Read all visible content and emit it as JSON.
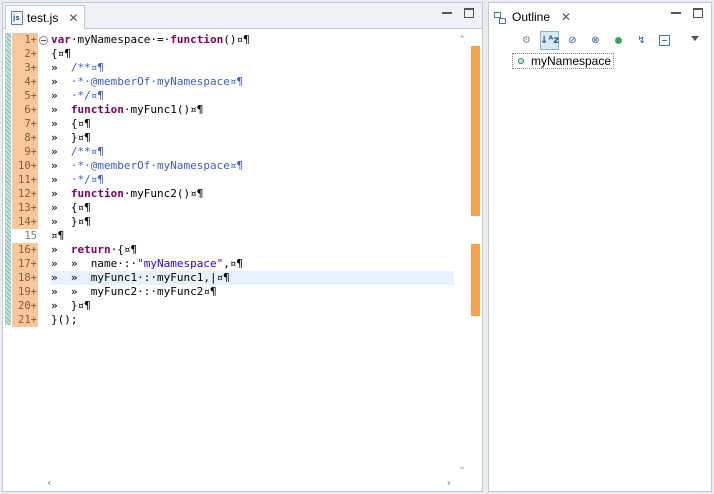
{
  "editor": {
    "tab_label": "test.js",
    "line_numbers": [
      {
        "num": "1+",
        "changed": true
      },
      {
        "num": "2+",
        "changed": true
      },
      {
        "num": "3+",
        "changed": true
      },
      {
        "num": "4+",
        "changed": true
      },
      {
        "num": "5+",
        "changed": true
      },
      {
        "num": "6+",
        "changed": true
      },
      {
        "num": "7+",
        "changed": true
      },
      {
        "num": "8+",
        "changed": true
      },
      {
        "num": "9+",
        "changed": true
      },
      {
        "num": "10+",
        "changed": true
      },
      {
        "num": "11+",
        "changed": true
      },
      {
        "num": "12+",
        "changed": true
      },
      {
        "num": "13+",
        "changed": true
      },
      {
        "num": "14+",
        "changed": true
      },
      {
        "num": "15",
        "changed": false
      },
      {
        "num": "16+",
        "changed": true
      },
      {
        "num": "17+",
        "changed": true
      },
      {
        "num": "18+",
        "changed": true
      },
      {
        "num": "19+",
        "changed": true
      },
      {
        "num": "20+",
        "changed": true
      },
      {
        "num": "21+",
        "changed": true
      }
    ],
    "code_lines": [
      [
        [
          "kw",
          "var"
        ],
        [
          "",
          "·myNamespace·=·"
        ],
        [
          "kw",
          "function"
        ],
        [
          "",
          "()¤¶"
        ]
      ],
      [
        [
          "",
          "{¤¶"
        ]
      ],
      [
        [
          "",
          "»  "
        ],
        [
          "cm",
          "/**¤¶"
        ]
      ],
      [
        [
          "",
          "»  "
        ],
        [
          "cm",
          "·*·@memberOf·myNamespace¤¶"
        ]
      ],
      [
        [
          "",
          "»  "
        ],
        [
          "cm",
          "·*/¤¶"
        ]
      ],
      [
        [
          "",
          "»  "
        ],
        [
          "kw",
          "function"
        ],
        [
          "",
          "·myFunc1()¤¶"
        ]
      ],
      [
        [
          "",
          "»  {¤¶"
        ]
      ],
      [
        [
          "",
          "»  }¤¶"
        ]
      ],
      [
        [
          "",
          "»  "
        ],
        [
          "cm",
          "/**¤¶"
        ]
      ],
      [
        [
          "",
          "»  "
        ],
        [
          "cm",
          "·*·@memberOf·myNamespace¤¶"
        ]
      ],
      [
        [
          "",
          "»  "
        ],
        [
          "cm",
          "·*/¤¶"
        ]
      ],
      [
        [
          "",
          "»  "
        ],
        [
          "kw",
          "function"
        ],
        [
          "",
          "·myFunc2()¤¶"
        ]
      ],
      [
        [
          "",
          "»  {¤¶"
        ]
      ],
      [
        [
          "",
          "»  }¤¶"
        ]
      ],
      [
        [
          "",
          "¤¶"
        ]
      ],
      [
        [
          "",
          "»  "
        ],
        [
          "kw",
          "return"
        ],
        [
          "",
          "·{¤¶"
        ]
      ],
      [
        [
          "",
          "»  »  name·:·"
        ],
        [
          "str",
          "\"myNamespace\""
        ],
        [
          "",
          ",¤¶"
        ]
      ],
      [
        [
          "",
          "»  »  myFunc1·:·myFunc1,|¤¶"
        ]
      ],
      [
        [
          "",
          "»  »  myFunc2·:·myFunc2¤¶"
        ]
      ],
      [
        [
          "",
          "»  }¤¶"
        ]
      ],
      [
        [
          "",
          "}();"
        ]
      ]
    ],
    "current_line_index": 17
  },
  "outline": {
    "tab_label": "Outline",
    "items": [
      {
        "label": "myNamespace"
      }
    ]
  }
}
